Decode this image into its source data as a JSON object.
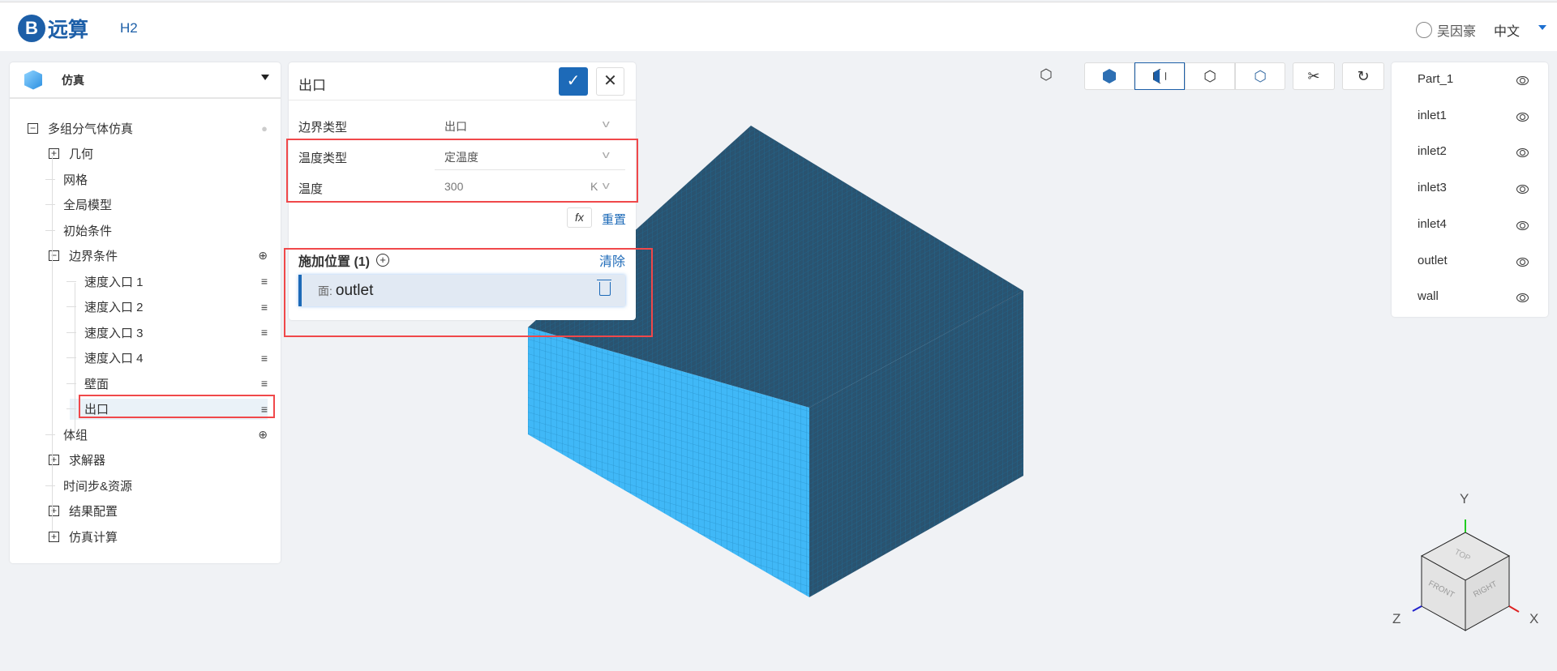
{
  "header": {
    "logo_mark": "B",
    "logo_text": "远算",
    "project": "H2",
    "user": "吴因豪",
    "language": "中文"
  },
  "left_panel": {
    "title": "仿真",
    "tree": [
      {
        "label": "多组分气体仿真",
        "level": 0,
        "toggle": "−",
        "action": "info-icon"
      },
      {
        "label": "几何",
        "level": 1,
        "toggle": "+"
      },
      {
        "label": "网格",
        "level": 1
      },
      {
        "label": "全局模型",
        "level": 1
      },
      {
        "label": "初始条件",
        "level": 1
      },
      {
        "label": "边界条件",
        "level": 1,
        "toggle": "−",
        "action": "add-icon"
      },
      {
        "label": "速度入口 1",
        "level": 2,
        "action": "menu-icon"
      },
      {
        "label": "速度入口 2",
        "level": 2,
        "action": "menu-icon"
      },
      {
        "label": "速度入口 3",
        "level": 2,
        "action": "menu-icon"
      },
      {
        "label": "速度入口 4",
        "level": 2,
        "action": "menu-icon"
      },
      {
        "label": "壁面",
        "level": 2,
        "action": "menu-icon"
      },
      {
        "label": "出口",
        "level": 2,
        "action": "menu-icon",
        "selected": true
      },
      {
        "label": "体组",
        "level": 1,
        "action": "add-icon"
      },
      {
        "label": "求解器",
        "level": 1,
        "toggle": "+"
      },
      {
        "label": "时间步&资源",
        "level": 1
      },
      {
        "label": "结果配置",
        "level": 1,
        "toggle": "+"
      },
      {
        "label": "仿真计算",
        "level": 1,
        "toggle": "+"
      }
    ]
  },
  "form": {
    "title": "出口",
    "confirm": "✓",
    "close": "✕",
    "fields": [
      {
        "label": "边界类型",
        "value": "出口"
      },
      {
        "label": "温度类型",
        "value": "定温度"
      },
      {
        "label": "温度",
        "value": "300",
        "unit": "K"
      }
    ],
    "fx": "fx",
    "reset": "重置",
    "apply_title": "施加位置 (1)",
    "clear": "清除",
    "location": {
      "kind": "面:",
      "name": "outlet"
    }
  },
  "toolbar": {
    "scissors": "✂",
    "rotate": "↻"
  },
  "parts": [
    "Part_1",
    "inlet1",
    "inlet2",
    "inlet3",
    "inlet4",
    "outlet",
    "wall"
  ],
  "axes": {
    "y": "Y",
    "z": "Z",
    "x": "X",
    "faces": [
      "TOP",
      "FRONT",
      "RIGHT"
    ]
  },
  "colors": {
    "accent": "#1d6ab8",
    "highlight": "#f0484a",
    "mesh_front": "#3fb6f5",
    "mesh_dark": "#2a5370"
  }
}
